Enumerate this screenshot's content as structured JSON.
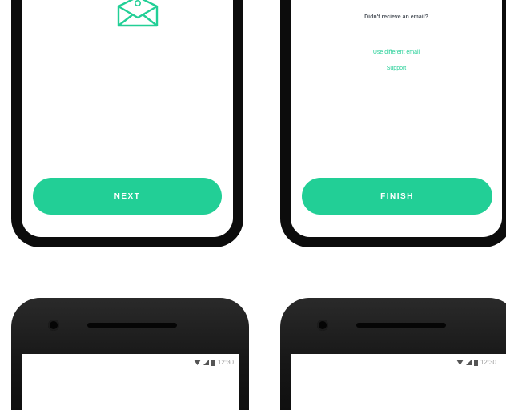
{
  "screens": {
    "next_screen": {
      "button_label": "NEXT",
      "icon": "envelope-at-icon"
    },
    "finish_screen": {
      "helper_text": "Didn't recieve an email?",
      "link_different_email": "Use different email",
      "link_support": "Support",
      "button_label": "FINISH"
    },
    "status_bar_left": {
      "time": "12:30"
    },
    "status_bar_right": {
      "time": "12:30"
    }
  },
  "colors": {
    "accent": "#22cf96",
    "phone_body": "#0c0c0c",
    "text_muted": "#555b63"
  }
}
